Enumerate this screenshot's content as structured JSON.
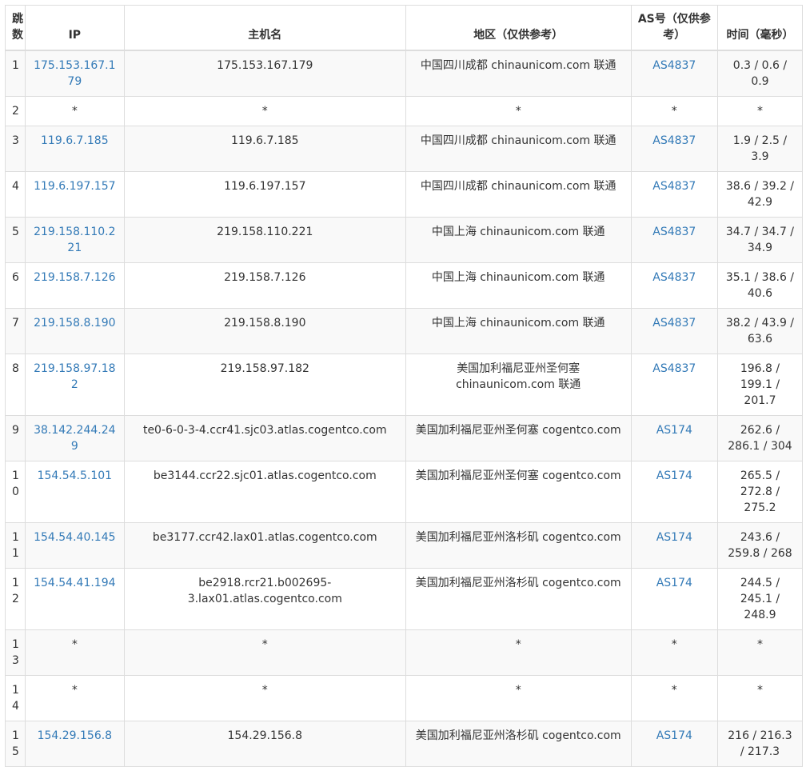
{
  "headers": {
    "hop": "跳数",
    "ip": "IP",
    "hostname": "主机名",
    "location": "地区（仅供参考）",
    "as": "AS号（仅供参考）",
    "time": "时间（毫秒）"
  },
  "rows": [
    {
      "hop": "1",
      "ip": "175.153.167.179",
      "hostname": "175.153.167.179",
      "location": "中国四川成都 chinaunicom.com 联通",
      "as": "AS4837",
      "time": "0.3 / 0.6 / 0.9"
    },
    {
      "hop": "2",
      "ip": "*",
      "hostname": "*",
      "location": "*",
      "as": "*",
      "time": "*"
    },
    {
      "hop": "3",
      "ip": "119.6.7.185",
      "hostname": "119.6.7.185",
      "location": "中国四川成都 chinaunicom.com 联通",
      "as": "AS4837",
      "time": "1.9 / 2.5 / 3.9"
    },
    {
      "hop": "4",
      "ip": "119.6.197.157",
      "hostname": "119.6.197.157",
      "location": "中国四川成都 chinaunicom.com 联通",
      "as": "AS4837",
      "time": "38.6 / 39.2 / 42.9"
    },
    {
      "hop": "5",
      "ip": "219.158.110.221",
      "hostname": "219.158.110.221",
      "location": "中国上海 chinaunicom.com 联通",
      "as": "AS4837",
      "time": "34.7 / 34.7 / 34.9"
    },
    {
      "hop": "6",
      "ip": "219.158.7.126",
      "hostname": "219.158.7.126",
      "location": "中国上海 chinaunicom.com 联通",
      "as": "AS4837",
      "time": "35.1 / 38.6 / 40.6"
    },
    {
      "hop": "7",
      "ip": "219.158.8.190",
      "hostname": "219.158.8.190",
      "location": "中国上海 chinaunicom.com 联通",
      "as": "AS4837",
      "time": "38.2 / 43.9 / 63.6"
    },
    {
      "hop": "8",
      "ip": "219.158.97.182",
      "hostname": "219.158.97.182",
      "location": "美国加利福尼亚州圣何塞 chinaunicom.com 联通",
      "as": "AS4837",
      "time": "196.8 / 199.1 / 201.7"
    },
    {
      "hop": "9",
      "ip": "38.142.244.249",
      "hostname": "te0-6-0-3-4.ccr41.sjc03.atlas.cogentco.com",
      "location": "美国加利福尼亚州圣何塞 cogentco.com",
      "as": "AS174",
      "time": "262.6 / 286.1 / 304"
    },
    {
      "hop": "10",
      "ip": "154.54.5.101",
      "hostname": "be3144.ccr22.sjc01.atlas.cogentco.com",
      "location": "美国加利福尼亚州圣何塞 cogentco.com",
      "as": "AS174",
      "time": "265.5 / 272.8 / 275.2"
    },
    {
      "hop": "11",
      "ip": "154.54.40.145",
      "hostname": "be3177.ccr42.lax01.atlas.cogentco.com",
      "location": "美国加利福尼亚州洛杉矶 cogentco.com",
      "as": "AS174",
      "time": "243.6 / 259.8 / 268"
    },
    {
      "hop": "12",
      "ip": "154.54.41.194",
      "hostname": "be2918.rcr21.b002695-3.lax01.atlas.cogentco.com",
      "location": "美国加利福尼亚州洛杉矶 cogentco.com",
      "as": "AS174",
      "time": "244.5 / 245.1 / 248.9"
    },
    {
      "hop": "13",
      "ip": "*",
      "hostname": "*",
      "location": "*",
      "as": "*",
      "time": "*"
    },
    {
      "hop": "14",
      "ip": "*",
      "hostname": "*",
      "location": "*",
      "as": "*",
      "time": "*"
    },
    {
      "hop": "15",
      "ip": "154.29.156.8",
      "hostname": "154.29.156.8",
      "location": "美国加利福尼亚州洛杉矶 cogentco.com",
      "as": "AS174",
      "time": "216 / 216.3 / 217.3"
    }
  ],
  "colors": {
    "link": "#337ab7",
    "text": "#333333",
    "border": "#dddddd",
    "stripe": "#f9f9f9"
  }
}
